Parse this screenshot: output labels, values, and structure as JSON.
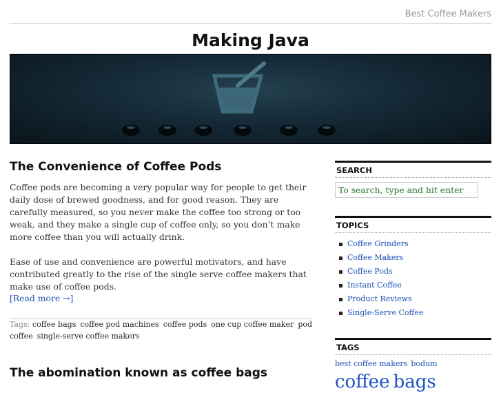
{
  "header": {
    "nav_link": "Best Coffee Makers",
    "site_title": "Making Java"
  },
  "posts": [
    {
      "title": "The Convenience of Coffee Pods",
      "paragraphs": [
        "Coffee pods are becoming a very popular way for people to get their daily dose of brewed goodness, and for good reason. They are carefully measured, so you never make the coffee too strong or too weak, and they make a single cup of coffee only, so you don’t make more coffee than you will actually drink.",
        "Ease of use and convenience are powerful motivators, and have contributed greatly to the rise of the single serve coffee makers that make use of coffee pods."
      ],
      "read_more": "[Read more →]",
      "tags_label": "Tags:",
      "tags": [
        "coffee bags",
        "coffee pod machines",
        "coffee pods",
        "one cup coffee maker",
        "pod coffee",
        "single-serve coffee makers"
      ]
    },
    {
      "title": "The abomination known as coffee bags"
    }
  ],
  "sidebar": {
    "search": {
      "heading": "SEARCH",
      "placeholder": "To search, type and hit enter"
    },
    "topics": {
      "heading": "TOPICS",
      "items": [
        "Coffee Grinders",
        "Coffee Makers",
        "Coffee Pods",
        "Instant Coffee",
        "Product Reviews",
        "Single-Serve Coffee"
      ]
    },
    "tags": {
      "heading": "TAGS",
      "items": [
        "best coffee makers",
        "bodum",
        "coffee",
        "bags"
      ]
    }
  },
  "colors": {
    "link": "#1a4fd6",
    "search_text": "#2a7a2a",
    "banner": "#142a36"
  },
  "icons": {
    "banner_graphic": "coffee-cup-icon",
    "topic_bullet": "square-bullet-icon"
  }
}
